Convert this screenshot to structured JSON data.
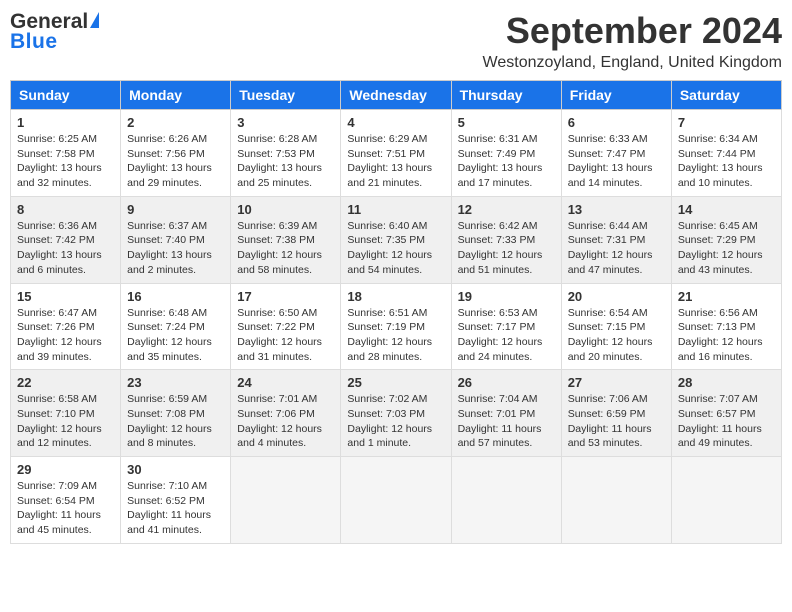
{
  "header": {
    "logo_general": "General",
    "logo_blue": "Blue",
    "month_year": "September 2024",
    "location": "Westonzoyland, England, United Kingdom"
  },
  "columns": [
    "Sunday",
    "Monday",
    "Tuesday",
    "Wednesday",
    "Thursday",
    "Friday",
    "Saturday"
  ],
  "weeks": [
    [
      {
        "day": "1",
        "sunrise": "Sunrise: 6:25 AM",
        "sunset": "Sunset: 7:58 PM",
        "daylight": "Daylight: 13 hours and 32 minutes."
      },
      {
        "day": "2",
        "sunrise": "Sunrise: 6:26 AM",
        "sunset": "Sunset: 7:56 PM",
        "daylight": "Daylight: 13 hours and 29 minutes."
      },
      {
        "day": "3",
        "sunrise": "Sunrise: 6:28 AM",
        "sunset": "Sunset: 7:53 PM",
        "daylight": "Daylight: 13 hours and 25 minutes."
      },
      {
        "day": "4",
        "sunrise": "Sunrise: 6:29 AM",
        "sunset": "Sunset: 7:51 PM",
        "daylight": "Daylight: 13 hours and 21 minutes."
      },
      {
        "day": "5",
        "sunrise": "Sunrise: 6:31 AM",
        "sunset": "Sunset: 7:49 PM",
        "daylight": "Daylight: 13 hours and 17 minutes."
      },
      {
        "day": "6",
        "sunrise": "Sunrise: 6:33 AM",
        "sunset": "Sunset: 7:47 PM",
        "daylight": "Daylight: 13 hours and 14 minutes."
      },
      {
        "day": "7",
        "sunrise": "Sunrise: 6:34 AM",
        "sunset": "Sunset: 7:44 PM",
        "daylight": "Daylight: 13 hours and 10 minutes."
      }
    ],
    [
      {
        "day": "8",
        "sunrise": "Sunrise: 6:36 AM",
        "sunset": "Sunset: 7:42 PM",
        "daylight": "Daylight: 13 hours and 6 minutes."
      },
      {
        "day": "9",
        "sunrise": "Sunrise: 6:37 AM",
        "sunset": "Sunset: 7:40 PM",
        "daylight": "Daylight: 13 hours and 2 minutes."
      },
      {
        "day": "10",
        "sunrise": "Sunrise: 6:39 AM",
        "sunset": "Sunset: 7:38 PM",
        "daylight": "Daylight: 12 hours and 58 minutes."
      },
      {
        "day": "11",
        "sunrise": "Sunrise: 6:40 AM",
        "sunset": "Sunset: 7:35 PM",
        "daylight": "Daylight: 12 hours and 54 minutes."
      },
      {
        "day": "12",
        "sunrise": "Sunrise: 6:42 AM",
        "sunset": "Sunset: 7:33 PM",
        "daylight": "Daylight: 12 hours and 51 minutes."
      },
      {
        "day": "13",
        "sunrise": "Sunrise: 6:44 AM",
        "sunset": "Sunset: 7:31 PM",
        "daylight": "Daylight: 12 hours and 47 minutes."
      },
      {
        "day": "14",
        "sunrise": "Sunrise: 6:45 AM",
        "sunset": "Sunset: 7:29 PM",
        "daylight": "Daylight: 12 hours and 43 minutes."
      }
    ],
    [
      {
        "day": "15",
        "sunrise": "Sunrise: 6:47 AM",
        "sunset": "Sunset: 7:26 PM",
        "daylight": "Daylight: 12 hours and 39 minutes."
      },
      {
        "day": "16",
        "sunrise": "Sunrise: 6:48 AM",
        "sunset": "Sunset: 7:24 PM",
        "daylight": "Daylight: 12 hours and 35 minutes."
      },
      {
        "day": "17",
        "sunrise": "Sunrise: 6:50 AM",
        "sunset": "Sunset: 7:22 PM",
        "daylight": "Daylight: 12 hours and 31 minutes."
      },
      {
        "day": "18",
        "sunrise": "Sunrise: 6:51 AM",
        "sunset": "Sunset: 7:19 PM",
        "daylight": "Daylight: 12 hours and 28 minutes."
      },
      {
        "day": "19",
        "sunrise": "Sunrise: 6:53 AM",
        "sunset": "Sunset: 7:17 PM",
        "daylight": "Daylight: 12 hours and 24 minutes."
      },
      {
        "day": "20",
        "sunrise": "Sunrise: 6:54 AM",
        "sunset": "Sunset: 7:15 PM",
        "daylight": "Daylight: 12 hours and 20 minutes."
      },
      {
        "day": "21",
        "sunrise": "Sunrise: 6:56 AM",
        "sunset": "Sunset: 7:13 PM",
        "daylight": "Daylight: 12 hours and 16 minutes."
      }
    ],
    [
      {
        "day": "22",
        "sunrise": "Sunrise: 6:58 AM",
        "sunset": "Sunset: 7:10 PM",
        "daylight": "Daylight: 12 hours and 12 minutes."
      },
      {
        "day": "23",
        "sunrise": "Sunrise: 6:59 AM",
        "sunset": "Sunset: 7:08 PM",
        "daylight": "Daylight: 12 hours and 8 minutes."
      },
      {
        "day": "24",
        "sunrise": "Sunrise: 7:01 AM",
        "sunset": "Sunset: 7:06 PM",
        "daylight": "Daylight: 12 hours and 4 minutes."
      },
      {
        "day": "25",
        "sunrise": "Sunrise: 7:02 AM",
        "sunset": "Sunset: 7:03 PM",
        "daylight": "Daylight: 12 hours and 1 minute."
      },
      {
        "day": "26",
        "sunrise": "Sunrise: 7:04 AM",
        "sunset": "Sunset: 7:01 PM",
        "daylight": "Daylight: 11 hours and 57 minutes."
      },
      {
        "day": "27",
        "sunrise": "Sunrise: 7:06 AM",
        "sunset": "Sunset: 6:59 PM",
        "daylight": "Daylight: 11 hours and 53 minutes."
      },
      {
        "day": "28",
        "sunrise": "Sunrise: 7:07 AM",
        "sunset": "Sunset: 6:57 PM",
        "daylight": "Daylight: 11 hours and 49 minutes."
      }
    ],
    [
      {
        "day": "29",
        "sunrise": "Sunrise: 7:09 AM",
        "sunset": "Sunset: 6:54 PM",
        "daylight": "Daylight: 11 hours and 45 minutes."
      },
      {
        "day": "30",
        "sunrise": "Sunrise: 7:10 AM",
        "sunset": "Sunset: 6:52 PM",
        "daylight": "Daylight: 11 hours and 41 minutes."
      },
      null,
      null,
      null,
      null,
      null
    ]
  ]
}
